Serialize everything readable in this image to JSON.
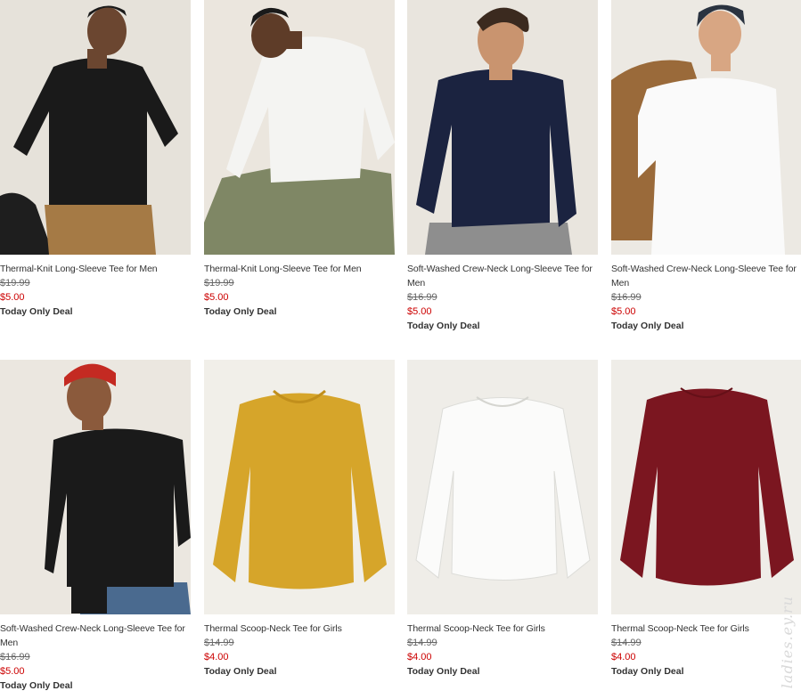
{
  "products": [
    {
      "name": "Thermal-Knit Long-Sleeve Tee for Men",
      "original_price": "$19.99",
      "sale_price": "$5.00",
      "badge": "Today Only Deal",
      "image": "man-black-thermal"
    },
    {
      "name": "Thermal-Knit Long-Sleeve Tee for Men",
      "original_price": "$19.99",
      "sale_price": "$5.00",
      "badge": "Today Only Deal",
      "image": "man-white-thermal"
    },
    {
      "name": "Soft-Washed Crew-Neck Long-Sleeve Tee for Men",
      "original_price": "$16.99",
      "sale_price": "$5.00",
      "badge": "Today Only Deal",
      "image": "man-navy-tee"
    },
    {
      "name": "Soft-Washed Crew-Neck Long-Sleeve Tee for Men",
      "original_price": "$16.99",
      "sale_price": "$5.00",
      "badge": "Today Only Deal",
      "image": "man-white-tee-beanie"
    },
    {
      "name": "Soft-Washed Crew-Neck Long-Sleeve Tee for Men",
      "original_price": "$16.99",
      "sale_price": "$5.00",
      "badge": "Today Only Deal",
      "image": "man-black-tee-red-beanie"
    },
    {
      "name": "Thermal Scoop-Neck Tee for Girls",
      "original_price": "$14.99",
      "sale_price": "$4.00",
      "badge": "Today Only Deal",
      "image": "mustard-thermal-flat"
    },
    {
      "name": "Thermal Scoop-Neck Tee for Girls",
      "original_price": "$14.99",
      "sale_price": "$4.00",
      "badge": "Today Only Deal",
      "image": "white-thermal-flat"
    },
    {
      "name": "Thermal Scoop-Neck Tee for Girls",
      "original_price": "$14.99",
      "sale_price": "$4.00",
      "badge": "Today Only Deal",
      "image": "burgundy-thermal-flat"
    }
  ],
  "watermark": "ladies.ey.ru",
  "colors": {
    "sale_price": "#cc0000",
    "text": "#333333",
    "strike": "#666666"
  }
}
